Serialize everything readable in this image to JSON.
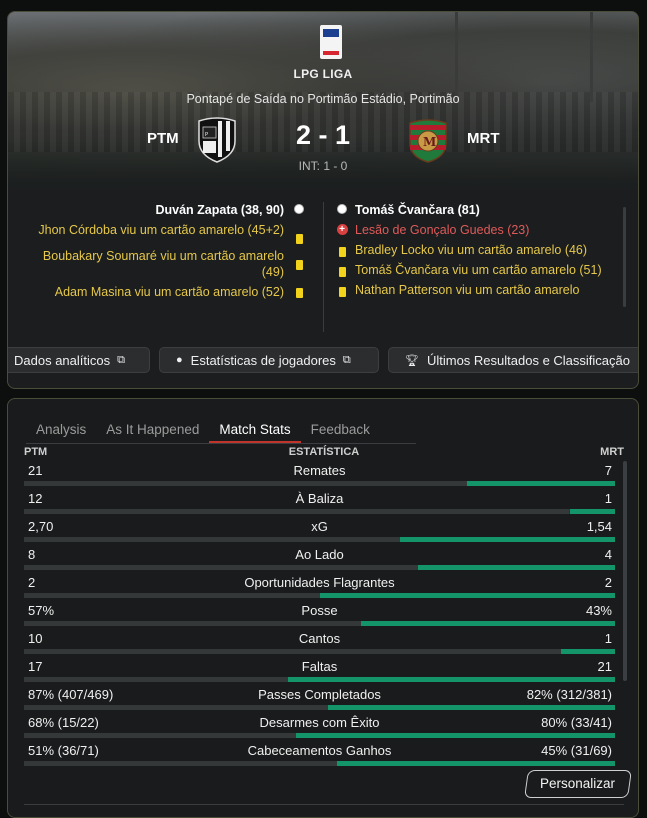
{
  "match": {
    "league": "LPG LIGA",
    "kickoff": "Pontapé de Saída no Portimão Estádio, Portimão",
    "home_abbr": "PTM",
    "away_abbr": "MRT",
    "score": "2 - 1",
    "half_time": "INT: 1 - 0"
  },
  "events": {
    "home": [
      {
        "text": "Duván Zapata (38, 90)",
        "type": "goal"
      },
      {
        "text": "Jhon Córdoba viu um cartão amarelo (45+2)",
        "type": "yellow"
      },
      {
        "text": "Boubakary Soumaré viu um cartão amarelo (49)",
        "type": "yellow"
      },
      {
        "text": "Adam Masina viu um cartão amarelo (52)",
        "type": "yellow"
      }
    ],
    "away": [
      {
        "text": "Tomáš Čvančara (81)",
        "type": "goal"
      },
      {
        "text": "Lesão de Gonçalo Guedes (23)",
        "type": "injury"
      },
      {
        "text": "Bradley Locko viu um cartão amarelo (46)",
        "type": "yellow"
      },
      {
        "text": "Tomáš Čvančara viu um cartão amarelo (51)",
        "type": "yellow"
      },
      {
        "text": "Nathan Patterson viu um cartão amarelo",
        "type": "yellow"
      }
    ]
  },
  "buttons": {
    "analytics": "Dados analíticos",
    "players": "Estatísticas de jogadores",
    "results": "Últimos Resultados e Classificação"
  },
  "tabs": [
    "Analysis",
    "As It Happened",
    "Match Stats",
    "Feedback"
  ],
  "active_tab": "Match Stats",
  "stats_header": {
    "home": "PTM",
    "title": "ESTATÍSTICA",
    "away": "MRT"
  },
  "stats": [
    {
      "label": "Remates",
      "home": "21",
      "away": "7",
      "home_share": 0.75
    },
    {
      "label": "À Baliza",
      "home": "12",
      "away": "1",
      "home_share": 0.923
    },
    {
      "label": "xG",
      "home": "2,70",
      "away": "1,54",
      "home_share": 0.637
    },
    {
      "label": "Ao Lado",
      "home": "8",
      "away": "4",
      "home_share": 0.667
    },
    {
      "label": "Oportunidades Flagrantes",
      "home": "2",
      "away": "2",
      "home_share": 0.5
    },
    {
      "label": "Posse",
      "home": "57%",
      "away": "43%",
      "home_share": 0.57
    },
    {
      "label": "Cantos",
      "home": "10",
      "away": "1",
      "home_share": 0.909
    },
    {
      "label": "Faltas",
      "home": "17",
      "away": "21",
      "home_share": 0.447
    },
    {
      "label": "Passes Completados",
      "home": "87% (407/469)",
      "away": "82% (312/381)",
      "home_share": 0.515
    },
    {
      "label": "Desarmes com Êxito",
      "home": "68% (15/22)",
      "away": "80% (33/41)",
      "home_share": 0.46
    },
    {
      "label": "Cabeceamentos Ganhos",
      "home": "51% (36/71)",
      "away": "45% (31/69)",
      "home_share": 0.53
    }
  ],
  "customize": "Personalizar",
  "colors": {
    "away_bar": "#139469",
    "home_bar": "#353839",
    "active_tab_underline": "#c0342c",
    "yellow_text": "#e6c84a",
    "injury_text": "#e05a5a"
  }
}
